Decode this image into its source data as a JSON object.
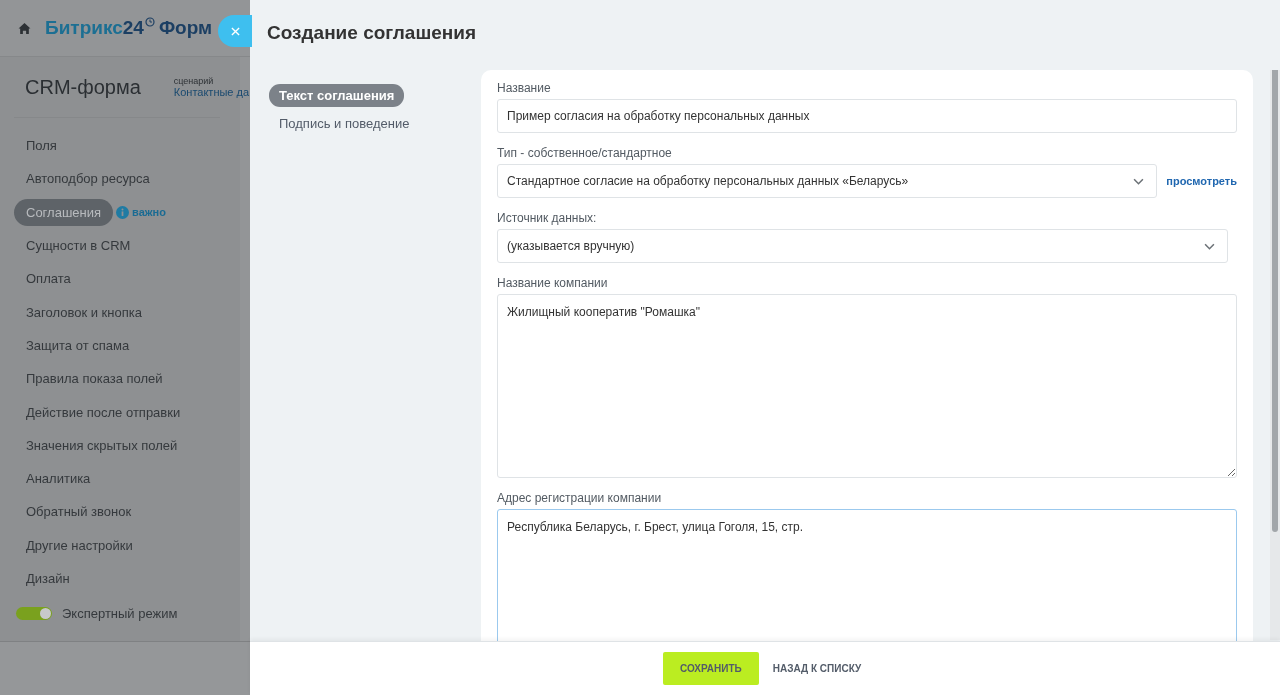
{
  "background": {
    "logo": {
      "brand": "Битрикс",
      "number": "24",
      "product": "Форм"
    },
    "form_title": "CRM-форма",
    "scenario": {
      "label": "сценарий",
      "value": "Контактные да"
    },
    "menu": [
      {
        "label": "Поля",
        "selected": false
      },
      {
        "label": "Автоподбор ресурса",
        "selected": false
      },
      {
        "label": "Соглашения",
        "selected": true,
        "badge": "важно"
      },
      {
        "label": "Сущности в CRM",
        "selected": false
      },
      {
        "label": "Оплата",
        "selected": false
      },
      {
        "label": "Заголовок и кнопка",
        "selected": false
      },
      {
        "label": "Защита от спама",
        "selected": false
      },
      {
        "label": "Правила показа полей",
        "selected": false
      },
      {
        "label": "Действие после отправки",
        "selected": false
      },
      {
        "label": "Значения скрытых полей",
        "selected": false
      },
      {
        "label": "Аналитика",
        "selected": false
      },
      {
        "label": "Обратный звонок",
        "selected": false
      },
      {
        "label": "Другие настройки",
        "selected": false
      },
      {
        "label": "Дизайн",
        "selected": false
      }
    ],
    "expert_mode": {
      "label": "Экспертный режим",
      "on": true
    }
  },
  "slider": {
    "title": "Создание соглашения",
    "tabs": [
      {
        "label": "Текст соглашения",
        "selected": true
      },
      {
        "label": "Подпись и поведение",
        "selected": false
      }
    ],
    "fields": [
      {
        "kind": "input",
        "label": "Название",
        "value": "Пример согласия на обработку персональных данных",
        "focused": false
      },
      {
        "kind": "select",
        "label": "Тип - собственное/стандартное",
        "value": "Стандартное согласие на обработку персональных данных «Беларусь»",
        "link": "просмотреть",
        "focused": false
      },
      {
        "kind": "select",
        "label": "Источник данных:",
        "value": "(указывается вручную)",
        "focused": false
      },
      {
        "kind": "textarea",
        "label": "Название компании",
        "value": "Жилищный кооператив \"Ромашка\"",
        "focused": false
      },
      {
        "kind": "textarea",
        "label": "Адрес регистрации компании",
        "value": "Республика Беларусь, г. Брест, улица Гоголя, 15, стр.",
        "focused": true
      }
    ],
    "buttons": [
      {
        "kind": "primary",
        "label": "СОХРАНИТЬ"
      },
      {
        "kind": "link",
        "label": "НАЗАД К СПИСКУ"
      }
    ]
  }
}
